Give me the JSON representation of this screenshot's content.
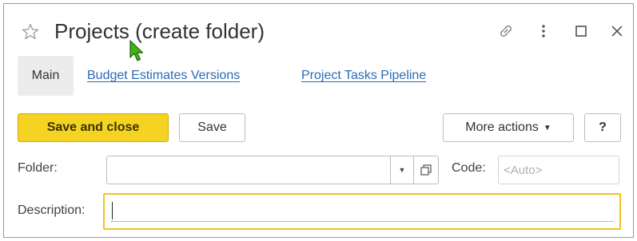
{
  "window": {
    "title": "Projects (create folder)",
    "icons": [
      "star-icon",
      "link-icon",
      "more-vertical-icon",
      "maximize-icon",
      "close-icon"
    ]
  },
  "tabs": [
    {
      "label": "Main",
      "active": true
    },
    {
      "label": "Budget Estimates Versions",
      "active": false
    },
    {
      "label": "Project Tasks Pipeline",
      "active": false
    }
  ],
  "toolbar": {
    "save_and_close": "Save and close",
    "save": "Save",
    "more_actions": "More actions",
    "help": "?"
  },
  "form": {
    "folder_label": "Folder:",
    "folder_value": "",
    "code_label": "Code:",
    "code_placeholder": "<Auto>",
    "description_label": "Description:",
    "description_value": ""
  },
  "colors": {
    "primary_button": "#f5d322",
    "link": "#2d6ab8",
    "focus_border": "#f2c21b",
    "cursor": "#3fb618"
  }
}
